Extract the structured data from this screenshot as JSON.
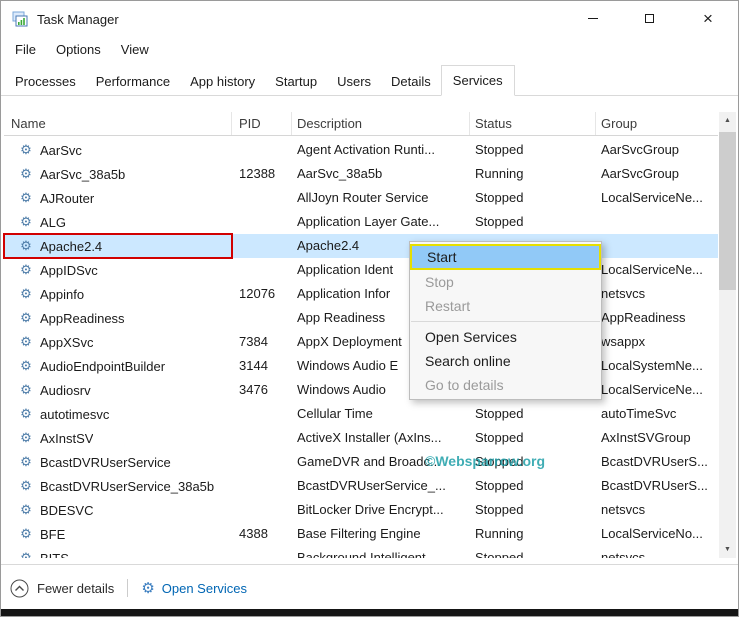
{
  "window": {
    "title": "Task Manager"
  },
  "menubar": {
    "items": [
      "File",
      "Options",
      "View"
    ]
  },
  "tabs": {
    "items": [
      "Processes",
      "Performance",
      "App history",
      "Startup",
      "Users",
      "Details",
      "Services"
    ],
    "active": "Services"
  },
  "table": {
    "columns": [
      "Name",
      "PID",
      "Description",
      "Status",
      "Group"
    ],
    "rows": [
      {
        "name": "AarSvc",
        "pid": "",
        "description": "Agent Activation Runti...",
        "status": "Stopped",
        "group": "AarSvcGroup"
      },
      {
        "name": "AarSvc_38a5b",
        "pid": "12388",
        "description": "AarSvc_38a5b",
        "status": "Running",
        "group": "AarSvcGroup"
      },
      {
        "name": "AJRouter",
        "pid": "",
        "description": "AllJoyn Router Service",
        "status": "Stopped",
        "group": "LocalServiceNe..."
      },
      {
        "name": "ALG",
        "pid": "",
        "description": "Application Layer Gate...",
        "status": "Stopped",
        "group": ""
      },
      {
        "name": "Apache2.4",
        "pid": "",
        "description": "Apache2.4",
        "status": "",
        "group": "",
        "selected": true
      },
      {
        "name": "AppIDSvc",
        "pid": "",
        "description": "Application Ident",
        "status": "",
        "group": "LocalServiceNe..."
      },
      {
        "name": "Appinfo",
        "pid": "12076",
        "description": "Application Infor",
        "status": "",
        "group": "netsvcs"
      },
      {
        "name": "AppReadiness",
        "pid": "",
        "description": "App Readiness",
        "status": "",
        "group": "AppReadiness"
      },
      {
        "name": "AppXSvc",
        "pid": "7384",
        "description": "AppX Deployment",
        "status": "",
        "group": "wsappx"
      },
      {
        "name": "AudioEndpointBuilder",
        "pid": "3144",
        "description": "Windows Audio E",
        "status": "",
        "group": "LocalSystemNe..."
      },
      {
        "name": "Audiosrv",
        "pid": "3476",
        "description": "Windows Audio",
        "status": "",
        "group": "LocalServiceNe..."
      },
      {
        "name": "autotimesvc",
        "pid": "",
        "description": "Cellular Time",
        "status": "Stopped",
        "group": "autoTimeSvc"
      },
      {
        "name": "AxInstSV",
        "pid": "",
        "description": "ActiveX Installer (AxIns...",
        "status": "Stopped",
        "group": "AxInstSVGroup"
      },
      {
        "name": "BcastDVRUserService",
        "pid": "",
        "description": "GameDVR and Broadc...",
        "status": "Stopped",
        "group": "BcastDVRUserS..."
      },
      {
        "name": "BcastDVRUserService_38a5b",
        "pid": "",
        "description": "BcastDVRUserService_...",
        "status": "Stopped",
        "group": "BcastDVRUserS..."
      },
      {
        "name": "BDESVC",
        "pid": "",
        "description": "BitLocker Drive Encrypt...",
        "status": "Stopped",
        "group": "netsvcs"
      },
      {
        "name": "BFE",
        "pid": "4388",
        "description": "Base Filtering Engine",
        "status": "Running",
        "group": "LocalServiceNo..."
      },
      {
        "name": "BITS",
        "pid": "",
        "description": "Background Intelligent...",
        "status": "Stopped",
        "group": "netsvcs"
      }
    ]
  },
  "context_menu": {
    "items": [
      {
        "label": "Start",
        "enabled": true,
        "highlighted": true,
        "annotated": true
      },
      {
        "label": "Stop",
        "enabled": false
      },
      {
        "label": "Restart",
        "enabled": false
      },
      {
        "separator": true
      },
      {
        "label": "Open Services",
        "enabled": true
      },
      {
        "label": "Search online",
        "enabled": true
      },
      {
        "label": "Go to details",
        "enabled": false
      }
    ]
  },
  "watermark": "©Websparrow.org",
  "footer": {
    "fewer_details": "Fewer details",
    "open_services": "Open Services"
  },
  "colors": {
    "selection_blue": "#cce8ff",
    "menu_highlight_blue": "#91c9f7",
    "annotation_red": "#d10000",
    "annotation_yellow": "#e6df00",
    "link_blue": "#0066b4",
    "watermark_teal": "#1f9fa8"
  }
}
